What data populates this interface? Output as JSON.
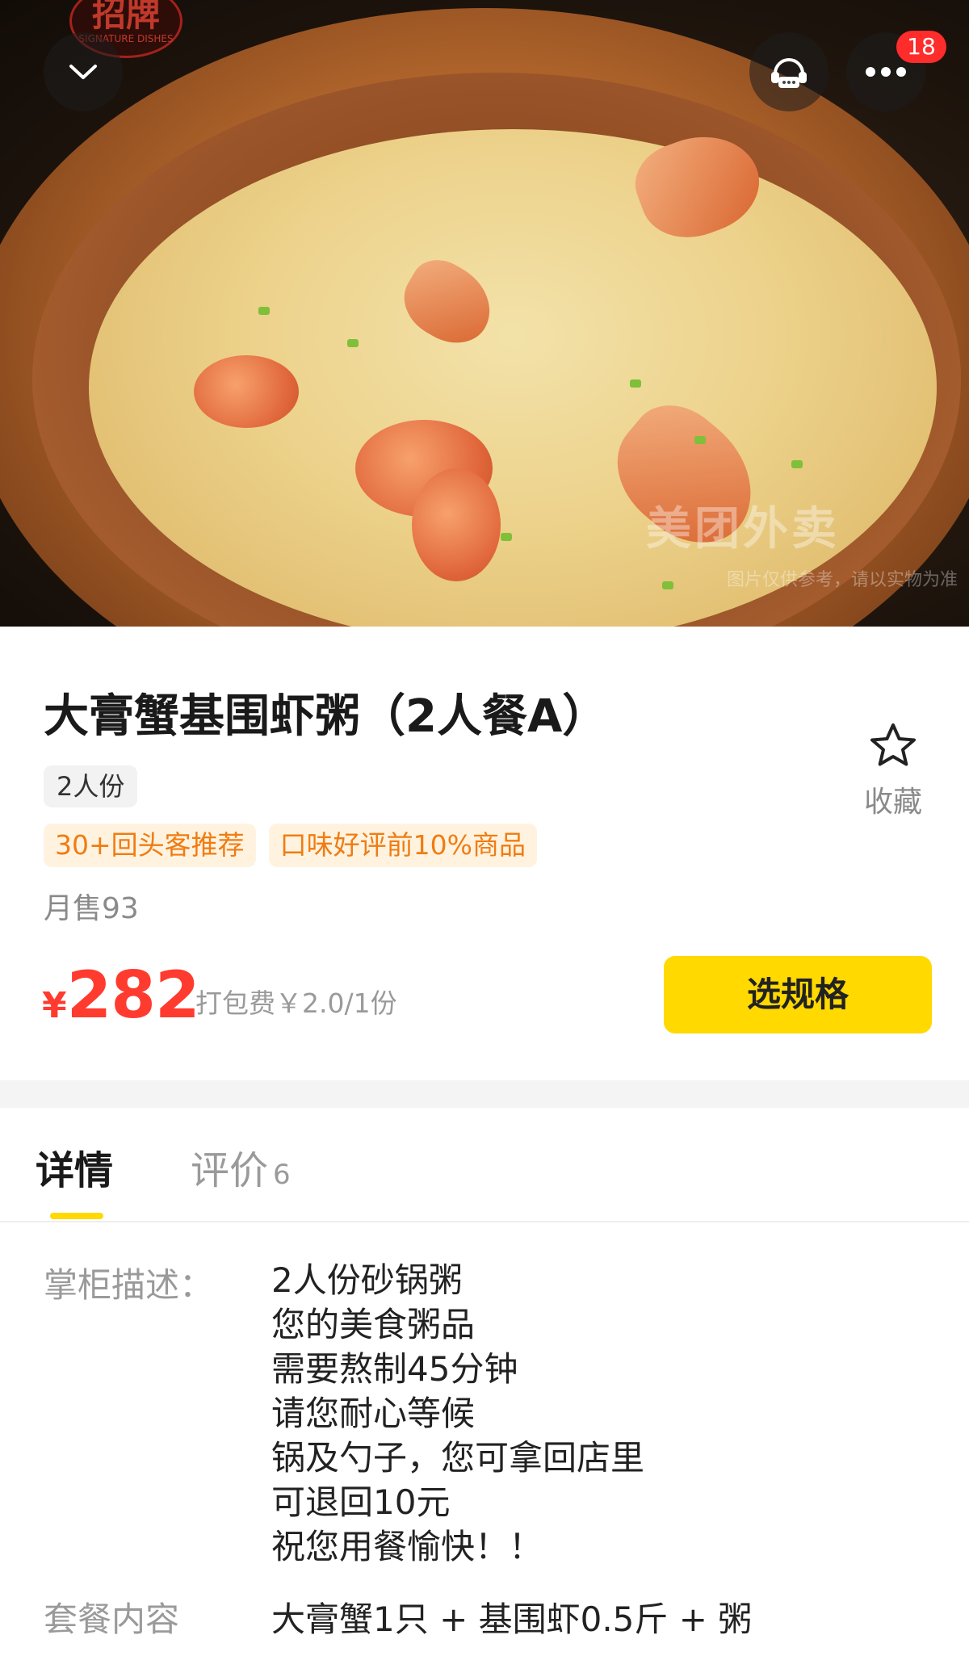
{
  "hero": {
    "signature_badge": "招牌",
    "signature_badge_sub": "SIGNATURE DISHES",
    "watermark": "美团外卖",
    "watermark_note": "图片仅供参考，请以实物为准",
    "cart_count": "18",
    "icons": [
      "chevron-down-icon",
      "customer-service-icon",
      "more-icon"
    ]
  },
  "product": {
    "title": "大膏蟹基围虾粥（2人餐A）",
    "portion": "2人份",
    "tags": [
      "30+回头客推荐",
      "口味好评前10%商品"
    ],
    "monthly_sales": "月售93",
    "currency": "¥",
    "price": "282",
    "packing_fee": "打包费￥2.0/1份",
    "select_button": "选规格",
    "favorite_label": "收藏"
  },
  "tabs": {
    "detail": "详情",
    "review": "评价",
    "review_count": "6"
  },
  "details": {
    "description_label": "掌柜描述：",
    "description_lines": [
      "2人份砂锅粥",
      "您的美食粥品",
      "需要熬制45分钟",
      "请您耐心等候",
      "锅及勺子，您可拿回店里",
      "可退回10元",
      "祝您用餐愉快！！"
    ],
    "package_label": "套餐内容",
    "package_value": "大膏蟹1只 + 基围虾0.5斤 + 粥"
  },
  "colors": {
    "accent_yellow": "#ffd900",
    "price_red": "#ff3b2f",
    "tag_orange": "#f07c12",
    "tag_bg": "#fff3e0",
    "badge_red": "#ff2c2c"
  }
}
